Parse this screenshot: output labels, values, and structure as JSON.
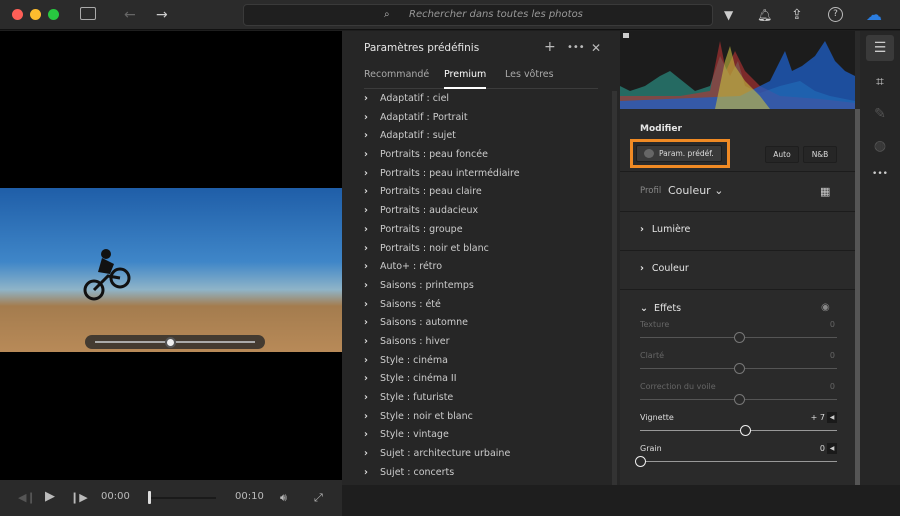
{
  "search": {
    "placeholder": "Rechercher dans toutes les photos"
  },
  "video": {
    "current_time": "00:00",
    "duration": "00:10",
    "progress": 0
  },
  "presets": {
    "title": "Paramètres prédéfinis",
    "tabs": [
      "Recommandé",
      "Premium",
      "Les vôtres"
    ],
    "active_tab": "Premium",
    "items": [
      "Adaptatif : ciel",
      "Adaptatif : Portrait",
      "Adaptatif : sujet",
      "Portraits : peau foncée",
      "Portraits : peau intermédiaire",
      "Portraits : peau claire",
      "Portraits : audacieux",
      "Portraits : groupe",
      "Portraits : noir et blanc",
      "Auto+ : rétro",
      "Saisons : printemps",
      "Saisons : été",
      "Saisons : automne",
      "Saisons : hiver",
      "Style : cinéma",
      "Style : cinéma II",
      "Style : futuriste",
      "Style : noir et blanc",
      "Style : vintage",
      "Sujet : architecture urbaine",
      "Sujet : concerts"
    ]
  },
  "edit": {
    "title": "Modifier",
    "presets_button": "Param. prédéf.",
    "auto_button": "Auto",
    "bw_button": "N&B",
    "profile_label": "Profil",
    "profile_value": "Couleur",
    "sections": {
      "light": "Lumière",
      "color": "Couleur",
      "effects": "Effets"
    },
    "sliders": [
      {
        "label": "Texture",
        "value": "0",
        "pos": 0.5
      },
      {
        "label": "Clarté",
        "value": "0",
        "pos": 0.5
      },
      {
        "label": "Correction du voile",
        "value": "0",
        "pos": 0.5
      },
      {
        "label": "Vignette",
        "value": "+ 7",
        "pos": 0.535
      },
      {
        "label": "Grain",
        "value": "0",
        "pos": 0
      }
    ]
  },
  "colors": {
    "accent": "#f08a24",
    "highlight_blue": "#1e6fd9"
  }
}
